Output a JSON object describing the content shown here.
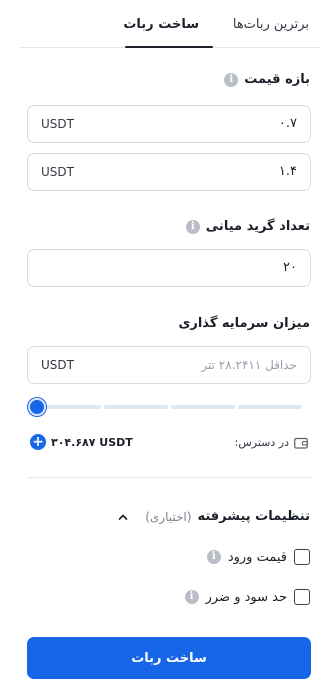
{
  "tabs": {
    "create": "ساخت ربات",
    "best": "برترین ربات‌ها"
  },
  "price_range": {
    "title": "بازه قیمت",
    "min_value": "۰.۷",
    "max_value": "۱.۴",
    "unit": "USDT"
  },
  "grid": {
    "title": "تعداد گرید میانی",
    "value": "۲۰"
  },
  "investment": {
    "title": "میزان سرمایه گذاری",
    "placeholder": "حداقل ۲۸.۲۴۱۱ تتر",
    "unit": "USDT",
    "slider_fraction": 0,
    "slider_segments": 4
  },
  "available": {
    "label": "در دسترس:",
    "value": "۳۰۴.۶۸۷ USDT",
    "plus": "+"
  },
  "advanced": {
    "title": "تنظیمات پیشرفته",
    "optional": "(اختیاری)",
    "entry_price": "قیمت ورود",
    "tp_sl": "حد سود و ضرر"
  },
  "submit_label": "ساخت ربات",
  "colors": {
    "accent": "#1766e8",
    "text": "#1c2029",
    "muted": "#9aa0ab"
  }
}
